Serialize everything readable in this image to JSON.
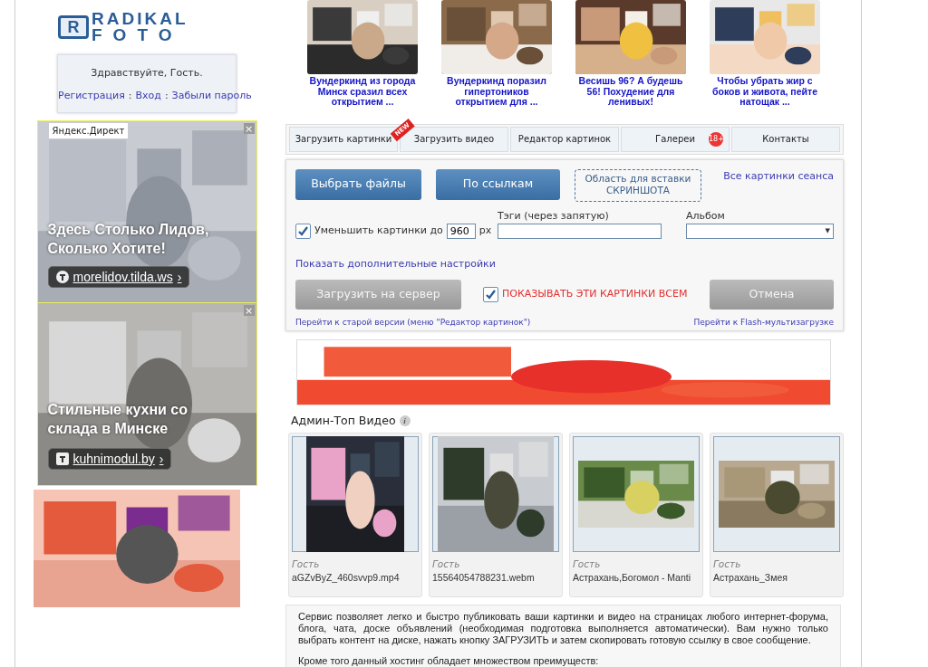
{
  "logo": {
    "line_1": "RADIKAL",
    "line_2": "FOTO",
    "mark": "R"
  },
  "greeting": {
    "text": "Здравствуйте, Гость.",
    "separator": ":",
    "links": [
      "Регистрация",
      "Вход",
      "Забыли пароль"
    ]
  },
  "left_ads": [
    {
      "label": "Яндекс.Директ",
      "close": "×",
      "headline": "Здесь Столько Лидов, Сколько Хотите!",
      "domain": "morelidov.tilda.ws",
      "arrow": "›"
    },
    {
      "close": "×",
      "headline": "Стильные кухни со склада в Минске",
      "domain": "kuhnimodul.by",
      "arrow": "›"
    }
  ],
  "top_news": [
    {
      "title": "Вундеркинд из города Минск сразил всех открытием ..."
    },
    {
      "title": "Вундеркинд поразил гипертоников открытием для ..."
    },
    {
      "title": "Весишь 96? А будешь 56! Похудение для ленивых!"
    },
    {
      "title": "Чтобы убрать жир с боков и живота, пейте натощак ..."
    }
  ],
  "nav_tabs": [
    {
      "label": "Загрузить картинки"
    },
    {
      "label": "Загрузить видео",
      "ribbon": "NEW"
    },
    {
      "label": "Редактор картинок"
    },
    {
      "label": "Галереи",
      "badge": "18+"
    },
    {
      "label": "Контакты"
    }
  ],
  "upload": {
    "choose_button": "Выбрать файлы",
    "links_button": "По ссылкам",
    "paste_area": "Область для вставки СКРИНШОТА",
    "session_link": "Все картинки сеанса",
    "resize": {
      "label": "Уменьшить картинки до",
      "checked": true,
      "value": "960",
      "unit": "px"
    },
    "tags": {
      "label": "Тэги (через запятую)"
    },
    "album": {
      "label": "Альбом",
      "caret": "▼"
    },
    "more_settings": "Показать дополнительные настройки",
    "submit_button": "Загрузить на сервер",
    "show_all": {
      "label": "ПОКАЗЫВАТЬ ЭТИ КАРТИНКИ ВСЕМ",
      "checked": true
    },
    "cancel_button": "Отмена",
    "old_version_link": "Перейти к старой версии (меню \"Редактор картинок\")",
    "flash_link": "Перейти к Flash-мультизагрузке"
  },
  "top_videos": {
    "title": "Админ-Топ Видео",
    "info": "i",
    "items": [
      {
        "author": "Гость",
        "file": "aGZvByZ_460svvp9.mp4"
      },
      {
        "author": "Гость",
        "file": "15564054788231.webm"
      },
      {
        "author": "Гость",
        "file": "Астрахань,Богомол - Manti"
      },
      {
        "author": "Гость",
        "file": "Астрахань_Змея"
      }
    ]
  },
  "description": {
    "paragraphs": [
      "Сервис позволяет легко и быстро публиковать ваши картинки и видео на страницах любого интернет-форума, блога, чата, доске объявлений (необходимая подготовка выполняется автоматически). Вам нужно только выбрать контент на диске, нажать кнопку ЗАГРУЗИТЬ и затем скопировать готовую ссылку в свое сообщение.",
      "Кроме того данный хостинг обладает множеством преимуществ:"
    ]
  }
}
